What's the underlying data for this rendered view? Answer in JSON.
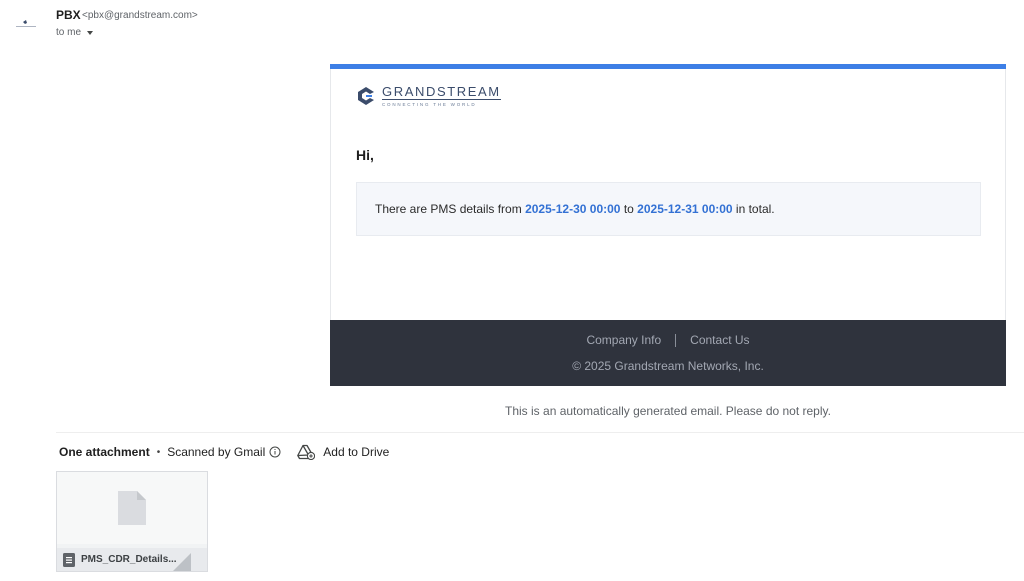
{
  "sender": {
    "name": "PBX",
    "email": "<pbx@grandstream.com>",
    "to": "to me"
  },
  "email": {
    "logo_name": "GRANDSTREAM",
    "logo_tagline": "CONNECTING THE WORLD",
    "greeting": "Hi,",
    "message_prefix": "There are PMS details from ",
    "date_from": "2025-12-30 00:00",
    "message_middle": " to ",
    "date_to": "2025-12-31 00:00",
    "message_suffix": " in total.",
    "footer": {
      "company_info": "Company Info",
      "contact_us": "Contact Us",
      "copyright": "© 2025 Grandstream Networks, Inc."
    },
    "accent_color": "#3d7fe6",
    "footer_color": "#2f333d"
  },
  "auto_note": "This is an automatically generated email. Please do not reply.",
  "attachments": {
    "title": "One attachment",
    "scanned": "Scanned by Gmail",
    "add_to_drive": "Add to Drive",
    "files": [
      {
        "name": "PMS_CDR_Details...",
        "icon": "document-icon"
      }
    ]
  }
}
